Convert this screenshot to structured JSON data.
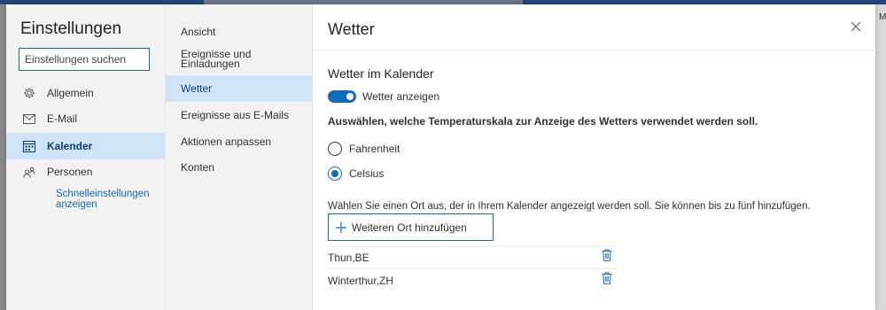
{
  "colors": {
    "accent": "#0f6cbd",
    "selected_bg": "#cfe4f6",
    "nav_bg": "#f3f2f1"
  },
  "settings": {
    "title": "Einstellungen",
    "search": {
      "placeholder": "Einstellungen suchen",
      "value": ""
    },
    "items": [
      {
        "label": "Allgemein",
        "icon": "gear-icon"
      },
      {
        "label": "E-Mail",
        "icon": "mail-icon"
      },
      {
        "label": "Kalender",
        "icon": "calendar-icon",
        "selected": true
      },
      {
        "label": "Personen",
        "icon": "people-icon"
      }
    ],
    "quick_link": "Schnelleinstellungen anzeigen"
  },
  "subnav": {
    "items": [
      {
        "label": "Ansicht"
      },
      {
        "label": "Ereignisse und Einladungen"
      },
      {
        "label": "Wetter",
        "selected": true
      },
      {
        "label": "Ereignisse aus E-Mails"
      },
      {
        "label": "Aktionen anpassen"
      },
      {
        "label": "Konten"
      }
    ]
  },
  "main": {
    "title": "Wetter",
    "section_title": "Wetter im Kalender",
    "toggle": {
      "label": "Wetter anzeigen",
      "on": true
    },
    "scale_question": "Auswählen, welche Temperaturskala zur Anzeige des Wetters verwendet werden soll.",
    "scale_options": [
      {
        "label": "Fahrenheit",
        "checked": false
      },
      {
        "label": "Celsius",
        "checked": true
      }
    ],
    "location_hint": "Wählen Sie einen Ort aus, der in Ihrem Kalender angezeigt werden soll. Sie können bis zu fünf hinzufügen.",
    "add_button": "Weiteren Ort hinzufügen",
    "locations": [
      "Thun,BE",
      "Winterthur,ZH"
    ]
  },
  "edge_text": "M"
}
